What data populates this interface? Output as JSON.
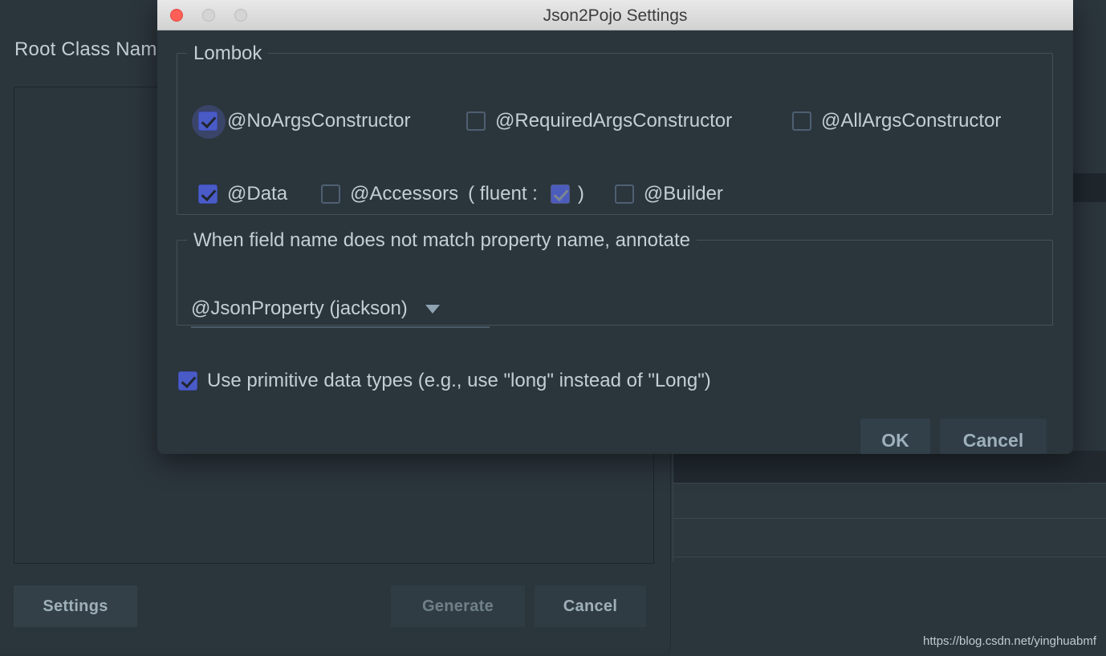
{
  "background_window": {
    "title": "Root Class Nam",
    "buttons": {
      "settings": "Settings",
      "generate": "Generate",
      "cancel": "Cancel"
    }
  },
  "watermark": "https://blog.csdn.net/yinghuabmf",
  "dialog": {
    "title": "Json2Pojo Settings",
    "traffic_lights": {
      "close": "close-button",
      "minimize": "minimize-button",
      "maximize": "maximize-button"
    },
    "lombok_group": {
      "legend": "Lombok",
      "row1": [
        {
          "label": "@NoArgsConstructor",
          "checked": true,
          "focused": true
        },
        {
          "label": "@RequiredArgsConstructor",
          "checked": false,
          "focused": false
        },
        {
          "label": "@AllArgsConstructor",
          "checked": false,
          "focused": false
        }
      ],
      "row2": {
        "data": {
          "label": "@Data",
          "checked": true
        },
        "accessors": {
          "label": "@Accessors",
          "checked": false
        },
        "fluent_open": "( fluent :",
        "fluent": {
          "label": "fluent-checkbox",
          "checked": true,
          "dimmed": true
        },
        "fluent_close": ")",
        "builder": {
          "label": "@Builder",
          "checked": false
        }
      }
    },
    "annotation_group": {
      "legend": "When field name does not match  property name, annotate",
      "select": {
        "value": "@JsonProperty (jackson)",
        "arrow": "chevron-down-icon"
      }
    },
    "primitive": {
      "label": "Use primitive data types (e.g., use \"long\" instead of \"Long\")",
      "checked": true
    },
    "buttons": {
      "ok": "OK",
      "cancel": "Cancel"
    }
  },
  "colors": {
    "dialog_bg": "#2b353c",
    "titlebar": "#e0e0e0",
    "checkbox_accent": "#4a5bc8",
    "text": "#c4ced5",
    "button_bg": "#32404a",
    "close_red": "#ff5f56"
  }
}
